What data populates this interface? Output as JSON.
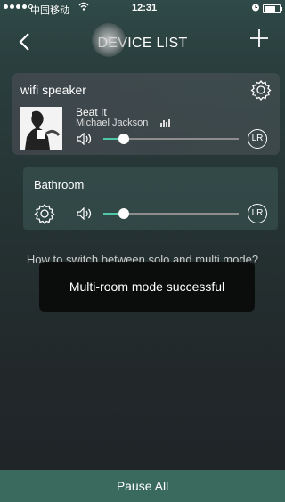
{
  "status_bar": {
    "carrier": "中国移动",
    "time": "12:31"
  },
  "nav": {
    "title": "DEVICE LIST",
    "back_icon": "chevron-left-icon",
    "add_icon": "plus-icon"
  },
  "devices": [
    {
      "name": "wifi speaker",
      "track_title": "Beat It",
      "artist": "Michael Jackson",
      "volume": 0.15,
      "channel": "LR"
    },
    {
      "name": "Bathroom",
      "volume": 0.15,
      "channel": "LR"
    }
  ],
  "help_text": "How to switch between solo and multi mode?",
  "toast": "Multi-room mode successful",
  "bottom_button": "Pause All",
  "colors": {
    "accent": "#4fc7a6",
    "bottom_bar": "#3a6a5e"
  }
}
